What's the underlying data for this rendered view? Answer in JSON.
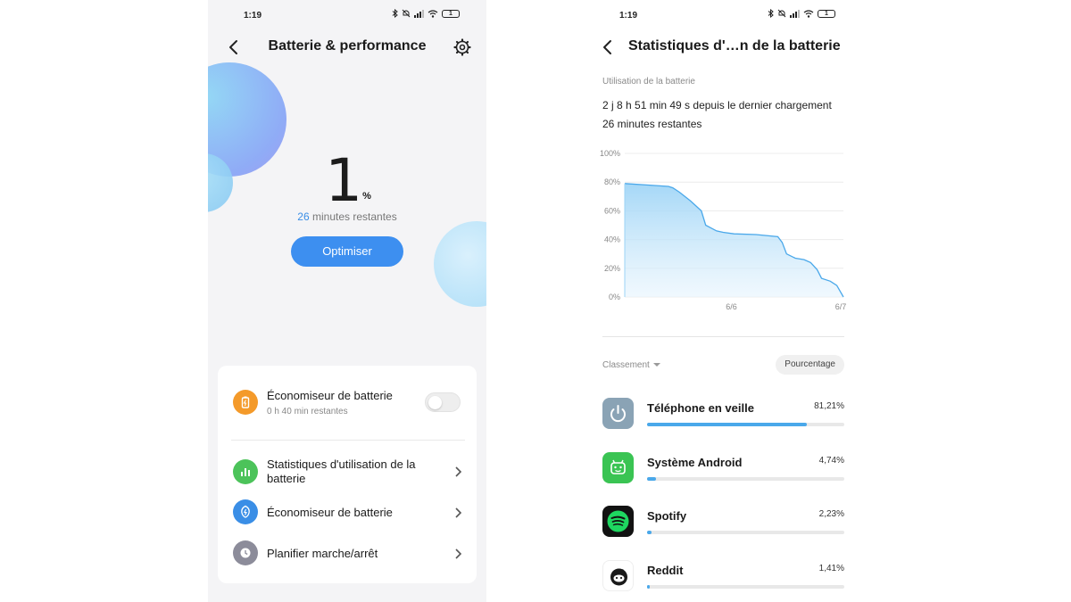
{
  "left": {
    "status": {
      "time": "1:19",
      "battery": "1"
    },
    "title": "Batterie & performance",
    "level_value": "1",
    "level_unit": "%",
    "remaining_minutes": "26",
    "remaining_text": "minutes restantes",
    "optimize_label": "Optimiser",
    "saver": {
      "label": "Économiseur de batterie",
      "sub": "0 h 40 min restantes",
      "enabled": false
    },
    "menu": [
      {
        "label": "Statistiques d'utilisation de la batterie",
        "icon": "bar-chart-icon",
        "color": "#4cc35a"
      },
      {
        "label": "Économiseur de batterie",
        "icon": "leaf-bolt-icon",
        "color": "#3a8ee6"
      },
      {
        "label": "Planifier marche/arrêt",
        "icon": "clock-icon",
        "color": "#8c8c9a"
      }
    ],
    "colors": {
      "accent": "#3d8ff0",
      "saver_icon": "#f49a2a"
    }
  },
  "right": {
    "status": {
      "time": "1:19",
      "battery": "1"
    },
    "title": "Statistiques d'…n de la batterie",
    "usage_header": "Utilisation de la batterie",
    "since_charge": "2 j 8 h 51 min 49 s depuis le dernier chargement",
    "remaining": "26 minutes restantes",
    "sort_label": "Classement",
    "sort_mode": "Pourcentage",
    "apps": [
      {
        "name": "Téléphone en veille",
        "percent": "81,21%",
        "value": 81.21,
        "icon": "power-icon"
      },
      {
        "name": "Système Android",
        "percent": "4,74%",
        "value": 4.74,
        "icon": "android-icon"
      },
      {
        "name": "Spotify",
        "percent": "2,23%",
        "value": 2.23,
        "icon": "spotify-icon"
      },
      {
        "name": "Reddit",
        "percent": "1,41%",
        "value": 1.41,
        "icon": "reddit-icon"
      }
    ]
  },
  "chart_data": {
    "type": "area",
    "yticks": [
      "100%",
      "80%",
      "60%",
      "40%",
      "20%",
      "0%"
    ],
    "xticks": [
      "6/6",
      "6/7"
    ],
    "ylim": [
      0,
      100
    ],
    "series": [
      {
        "x": [
          0,
          0.1,
          0.2,
          0.22,
          0.25,
          0.3,
          0.35,
          0.37,
          0.42,
          0.45,
          0.5,
          0.6,
          0.7,
          0.72,
          0.74,
          0.78,
          0.82,
          0.85,
          0.88,
          0.9,
          0.94,
          0.97,
          1.0
        ],
        "y": [
          79,
          78,
          77,
          76,
          73,
          67,
          60,
          50,
          46,
          45,
          44,
          43.5,
          42,
          38,
          30,
          27,
          26,
          24,
          19,
          13,
          11,
          8,
          0
        ]
      }
    ]
  }
}
